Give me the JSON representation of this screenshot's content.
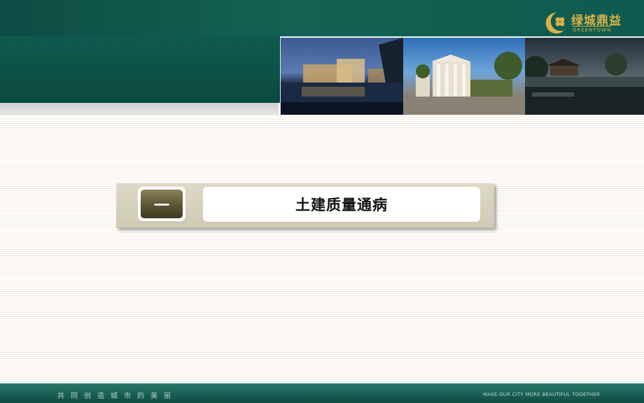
{
  "brand": {
    "name": "绿城鼎益",
    "sub": "GREENTOWN",
    "color": "#d8b04a"
  },
  "section": {
    "number": "一",
    "title": "土建质量通病"
  },
  "footer": {
    "slogan_cn": "共同创造城市的美丽",
    "slogan_en": "MAKE OUR CITY MORE BEAUTIFUL TOGETHER"
  },
  "colors": {
    "header_green": "#0f5a4e",
    "badge_olive": "#5b5535",
    "panel_beige": "#ded9c7"
  }
}
